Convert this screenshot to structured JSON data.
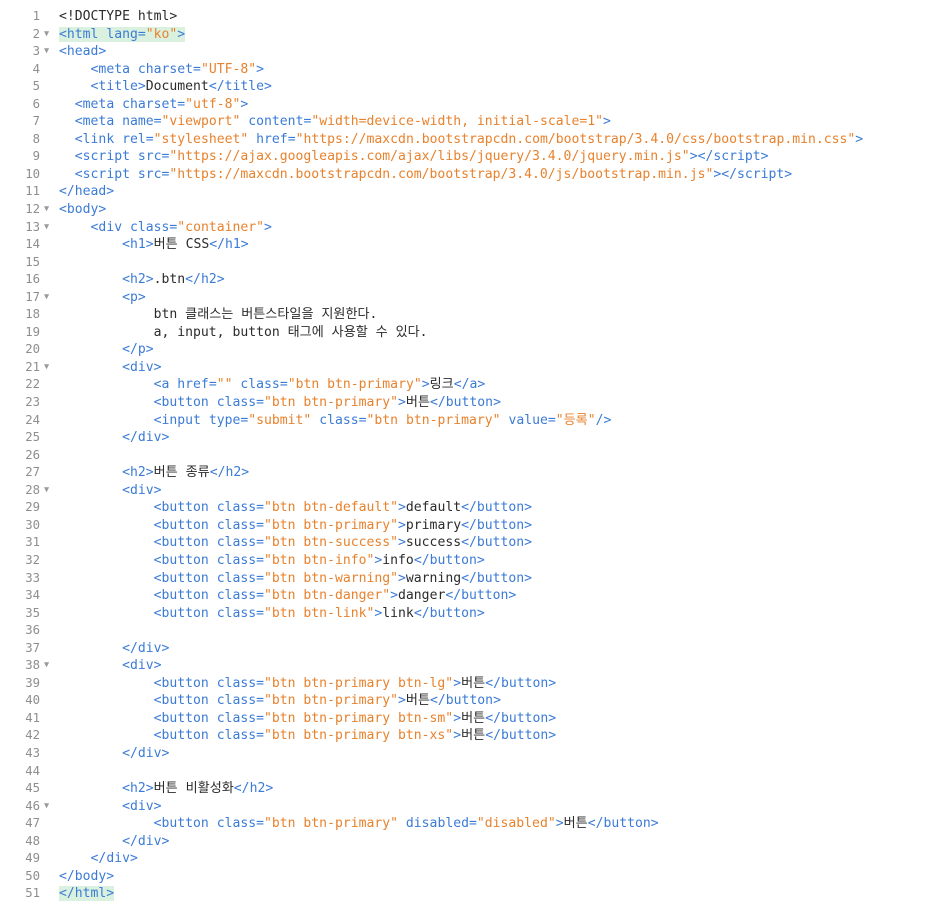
{
  "editor": {
    "lines": [
      {
        "num": "1",
        "fold": "",
        "html": "<span class=\"t-doc\">&lt;!DOCTYPE html&gt;</span>"
      },
      {
        "num": "2",
        "fold": "▼",
        "html": "<span class=\"hl\"><span class=\"t-tag\">&lt;html</span> <span class=\"t-attr\">lang</span><span class=\"t-tag\">=</span><span class=\"t-str\">\"ko\"</span><span class=\"t-tag\">&gt;</span></span>"
      },
      {
        "num": "3",
        "fold": "▼",
        "html": "<span class=\"t-tag\">&lt;head&gt;</span>"
      },
      {
        "num": "4",
        "fold": "",
        "html": "    <span class=\"t-tag\">&lt;meta</span> <span class=\"t-attr\">charset</span><span class=\"t-tag\">=</span><span class=\"t-str\">\"UTF-8\"</span><span class=\"t-tag\">&gt;</span>"
      },
      {
        "num": "5",
        "fold": "",
        "html": "    <span class=\"t-tag\">&lt;title&gt;</span><span class=\"t-text\">Document</span><span class=\"t-tag\">&lt;/title&gt;</span>"
      },
      {
        "num": "6",
        "fold": "",
        "html": "  <span class=\"t-tag\">&lt;meta</span> <span class=\"t-attr\">charset</span><span class=\"t-tag\">=</span><span class=\"t-str\">\"utf-8\"</span><span class=\"t-tag\">&gt;</span>"
      },
      {
        "num": "7",
        "fold": "",
        "html": "  <span class=\"t-tag\">&lt;meta</span> <span class=\"t-attr\">name</span><span class=\"t-tag\">=</span><span class=\"t-str\">\"viewport\"</span> <span class=\"t-attr\">content</span><span class=\"t-tag\">=</span><span class=\"t-str\">\"width=device-width, initial-scale=1\"</span><span class=\"t-tag\">&gt;</span>"
      },
      {
        "num": "8",
        "fold": "",
        "html": "  <span class=\"t-tag\">&lt;link</span> <span class=\"t-attr\">rel</span><span class=\"t-tag\">=</span><span class=\"t-str\">\"stylesheet\"</span> <span class=\"t-attr\">href</span><span class=\"t-tag\">=</span><span class=\"t-str\">\"https://maxcdn.bootstrapcdn.com/bootstrap/3.4.0/css/bootstrap.min.css\"</span><span class=\"t-tag\">&gt;</span>"
      },
      {
        "num": "9",
        "fold": "",
        "html": "  <span class=\"t-tag\">&lt;script</span> <span class=\"t-attr\">src</span><span class=\"t-tag\">=</span><span class=\"t-str\">\"https://ajax.googleapis.com/ajax/libs/jquery/3.4.0/jquery.min.js\"</span><span class=\"t-tag\">&gt;&lt;/script&gt;</span>"
      },
      {
        "num": "10",
        "fold": "",
        "html": "  <span class=\"t-tag\">&lt;script</span> <span class=\"t-attr\">src</span><span class=\"t-tag\">=</span><span class=\"t-str\">\"https://maxcdn.bootstrapcdn.com/bootstrap/3.4.0/js/bootstrap.min.js\"</span><span class=\"t-tag\">&gt;&lt;/script&gt;</span>"
      },
      {
        "num": "11",
        "fold": "",
        "html": "<span class=\"t-tag\">&lt;/head&gt;</span>"
      },
      {
        "num": "12",
        "fold": "▼",
        "html": "<span class=\"t-tag\">&lt;body&gt;</span>"
      },
      {
        "num": "13",
        "fold": "▼",
        "html": "    <span class=\"t-tag\">&lt;div</span> <span class=\"t-attr\">class</span><span class=\"t-tag\">=</span><span class=\"t-str\">\"container\"</span><span class=\"t-tag\">&gt;</span>"
      },
      {
        "num": "14",
        "fold": "",
        "html": "        <span class=\"t-tag\">&lt;h1&gt;</span><span class=\"t-text\">버튼 CSS</span><span class=\"t-tag\">&lt;/h1&gt;</span>"
      },
      {
        "num": "15",
        "fold": "",
        "html": ""
      },
      {
        "num": "16",
        "fold": "",
        "html": "        <span class=\"t-tag\">&lt;h2&gt;</span><span class=\"t-text\">.btn</span><span class=\"t-tag\">&lt;/h2&gt;</span>"
      },
      {
        "num": "17",
        "fold": "▼",
        "html": "        <span class=\"t-tag\">&lt;p&gt;</span>"
      },
      {
        "num": "18",
        "fold": "",
        "html": "            <span class=\"t-text\">btn 클래스는 버튼스타일을 지원한다.</span>"
      },
      {
        "num": "19",
        "fold": "",
        "html": "            <span class=\"t-text\">a, input, button 태그에 사용할 수 있다.</span>"
      },
      {
        "num": "20",
        "fold": "",
        "html": "        <span class=\"t-tag\">&lt;/p&gt;</span>"
      },
      {
        "num": "21",
        "fold": "▼",
        "html": "        <span class=\"t-tag\">&lt;div&gt;</span>"
      },
      {
        "num": "22",
        "fold": "",
        "html": "            <span class=\"t-tag\">&lt;a</span> <span class=\"t-attr\">href</span><span class=\"t-tag\">=</span><span class=\"t-str\">\"\"</span> <span class=\"t-attr\">class</span><span class=\"t-tag\">=</span><span class=\"t-str\">\"btn btn-primary\"</span><span class=\"t-tag\">&gt;</span><span class=\"t-text\">링크</span><span class=\"t-tag\">&lt;/a&gt;</span>"
      },
      {
        "num": "23",
        "fold": "",
        "html": "            <span class=\"t-tag\">&lt;button</span> <span class=\"t-attr\">class</span><span class=\"t-tag\">=</span><span class=\"t-str\">\"btn btn-primary\"</span><span class=\"t-tag\">&gt;</span><span class=\"t-text\">버튼</span><span class=\"t-tag\">&lt;/button&gt;</span>"
      },
      {
        "num": "24",
        "fold": "",
        "html": "            <span class=\"t-tag\">&lt;input</span> <span class=\"t-attr\">type</span><span class=\"t-tag\">=</span><span class=\"t-str\">\"submit\"</span> <span class=\"t-attr\">class</span><span class=\"t-tag\">=</span><span class=\"t-str\">\"btn btn-primary\"</span> <span class=\"t-attr\">value</span><span class=\"t-tag\">=</span><span class=\"t-str\">\"등록\"</span><span class=\"t-tag\">/&gt;</span>"
      },
      {
        "num": "25",
        "fold": "",
        "html": "        <span class=\"t-tag\">&lt;/div&gt;</span>"
      },
      {
        "num": "26",
        "fold": "",
        "html": ""
      },
      {
        "num": "27",
        "fold": "",
        "html": "        <span class=\"t-tag\">&lt;h2&gt;</span><span class=\"t-text\">버튼 종류</span><span class=\"t-tag\">&lt;/h2&gt;</span>"
      },
      {
        "num": "28",
        "fold": "▼",
        "html": "        <span class=\"t-tag\">&lt;div&gt;</span>"
      },
      {
        "num": "29",
        "fold": "",
        "html": "            <span class=\"t-tag\">&lt;button</span> <span class=\"t-attr\">class</span><span class=\"t-tag\">=</span><span class=\"t-str\">\"btn btn-default\"</span><span class=\"t-tag\">&gt;</span><span class=\"t-text\">default</span><span class=\"t-tag\">&lt;/button&gt;</span>"
      },
      {
        "num": "30",
        "fold": "",
        "html": "            <span class=\"t-tag\">&lt;button</span> <span class=\"t-attr\">class</span><span class=\"t-tag\">=</span><span class=\"t-str\">\"btn btn-primary\"</span><span class=\"t-tag\">&gt;</span><span class=\"t-text\">primary</span><span class=\"t-tag\">&lt;/button&gt;</span>"
      },
      {
        "num": "31",
        "fold": "",
        "html": "            <span class=\"t-tag\">&lt;button</span> <span class=\"t-attr\">class</span><span class=\"t-tag\">=</span><span class=\"t-str\">\"btn btn-success\"</span><span class=\"t-tag\">&gt;</span><span class=\"t-text\">success</span><span class=\"t-tag\">&lt;/button&gt;</span>"
      },
      {
        "num": "32",
        "fold": "",
        "html": "            <span class=\"t-tag\">&lt;button</span> <span class=\"t-attr\">class</span><span class=\"t-tag\">=</span><span class=\"t-str\">\"btn btn-info\"</span><span class=\"t-tag\">&gt;</span><span class=\"t-text\">info</span><span class=\"t-tag\">&lt;/button&gt;</span>"
      },
      {
        "num": "33",
        "fold": "",
        "html": "            <span class=\"t-tag\">&lt;button</span> <span class=\"t-attr\">class</span><span class=\"t-tag\">=</span><span class=\"t-str\">\"btn btn-warning\"</span><span class=\"t-tag\">&gt;</span><span class=\"t-text\">warning</span><span class=\"t-tag\">&lt;/button&gt;</span>"
      },
      {
        "num": "34",
        "fold": "",
        "html": "            <span class=\"t-tag\">&lt;button</span> <span class=\"t-attr\">class</span><span class=\"t-tag\">=</span><span class=\"t-str\">\"btn btn-danger\"</span><span class=\"t-tag\">&gt;</span><span class=\"t-text\">danger</span><span class=\"t-tag\">&lt;/button&gt;</span>"
      },
      {
        "num": "35",
        "fold": "",
        "html": "            <span class=\"t-tag\">&lt;button</span> <span class=\"t-attr\">class</span><span class=\"t-tag\">=</span><span class=\"t-str\">\"btn btn-link\"</span><span class=\"t-tag\">&gt;</span><span class=\"t-text\">link</span><span class=\"t-tag\">&lt;/button&gt;</span>"
      },
      {
        "num": "36",
        "fold": "",
        "html": ""
      },
      {
        "num": "37",
        "fold": "",
        "html": "        <span class=\"t-tag\">&lt;/div&gt;</span>"
      },
      {
        "num": "38",
        "fold": "▼",
        "html": "        <span class=\"t-tag\">&lt;div&gt;</span>"
      },
      {
        "num": "39",
        "fold": "",
        "html": "            <span class=\"t-tag\">&lt;button</span> <span class=\"t-attr\">class</span><span class=\"t-tag\">=</span><span class=\"t-str\">\"btn btn-primary btn-lg\"</span><span class=\"t-tag\">&gt;</span><span class=\"t-text\">버튼</span><span class=\"t-tag\">&lt;/button&gt;</span>"
      },
      {
        "num": "40",
        "fold": "",
        "html": "            <span class=\"t-tag\">&lt;button</span> <span class=\"t-attr\">class</span><span class=\"t-tag\">=</span><span class=\"t-str\">\"btn btn-primary\"</span><span class=\"t-tag\">&gt;</span><span class=\"t-text\">버튼</span><span class=\"t-tag\">&lt;/button&gt;</span>"
      },
      {
        "num": "41",
        "fold": "",
        "html": "            <span class=\"t-tag\">&lt;button</span> <span class=\"t-attr\">class</span><span class=\"t-tag\">=</span><span class=\"t-str\">\"btn btn-primary btn-sm\"</span><span class=\"t-tag\">&gt;</span><span class=\"t-text\">버튼</span><span class=\"t-tag\">&lt;/button&gt;</span>"
      },
      {
        "num": "42",
        "fold": "",
        "html": "            <span class=\"t-tag\">&lt;button</span> <span class=\"t-attr\">class</span><span class=\"t-tag\">=</span><span class=\"t-str\">\"btn btn-primary btn-xs\"</span><span class=\"t-tag\">&gt;</span><span class=\"t-text\">버튼</span><span class=\"t-tag\">&lt;/button&gt;</span>"
      },
      {
        "num": "43",
        "fold": "",
        "html": "        <span class=\"t-tag\">&lt;/div&gt;</span>"
      },
      {
        "num": "44",
        "fold": "",
        "html": ""
      },
      {
        "num": "45",
        "fold": "",
        "html": "        <span class=\"t-tag\">&lt;h2&gt;</span><span class=\"t-text\">버튼 비활성화</span><span class=\"t-tag\">&lt;/h2&gt;</span>"
      },
      {
        "num": "46",
        "fold": "▼",
        "html": "        <span class=\"t-tag\">&lt;div&gt;</span>"
      },
      {
        "num": "47",
        "fold": "",
        "html": "            <span class=\"t-tag\">&lt;button</span> <span class=\"t-attr\">class</span><span class=\"t-tag\">=</span><span class=\"t-str\">\"btn btn-primary\"</span> <span class=\"t-attr\">disabled</span><span class=\"t-tag\">=</span><span class=\"t-str\">\"disabled\"</span><span class=\"t-tag\">&gt;</span><span class=\"t-text\">버튼</span><span class=\"t-tag\">&lt;/button&gt;</span>"
      },
      {
        "num": "48",
        "fold": "",
        "html": "        <span class=\"t-tag\">&lt;/div&gt;</span>"
      },
      {
        "num": "49",
        "fold": "",
        "html": "    <span class=\"t-tag\">&lt;/div&gt;</span>"
      },
      {
        "num": "50",
        "fold": "",
        "html": "<span class=\"t-tag\">&lt;/body&gt;</span>"
      },
      {
        "num": "51",
        "fold": "",
        "html": "<span class=\"hl\"><span class=\"t-tag\">&lt;/html&gt;</span></span>"
      }
    ]
  },
  "colors": {
    "tag": "#3b7bd6",
    "string": "#e8822d",
    "text": "#2b2b2b",
    "gutter": "#8e8e8e",
    "bracket_match_highlight": "#d9f1de"
  }
}
